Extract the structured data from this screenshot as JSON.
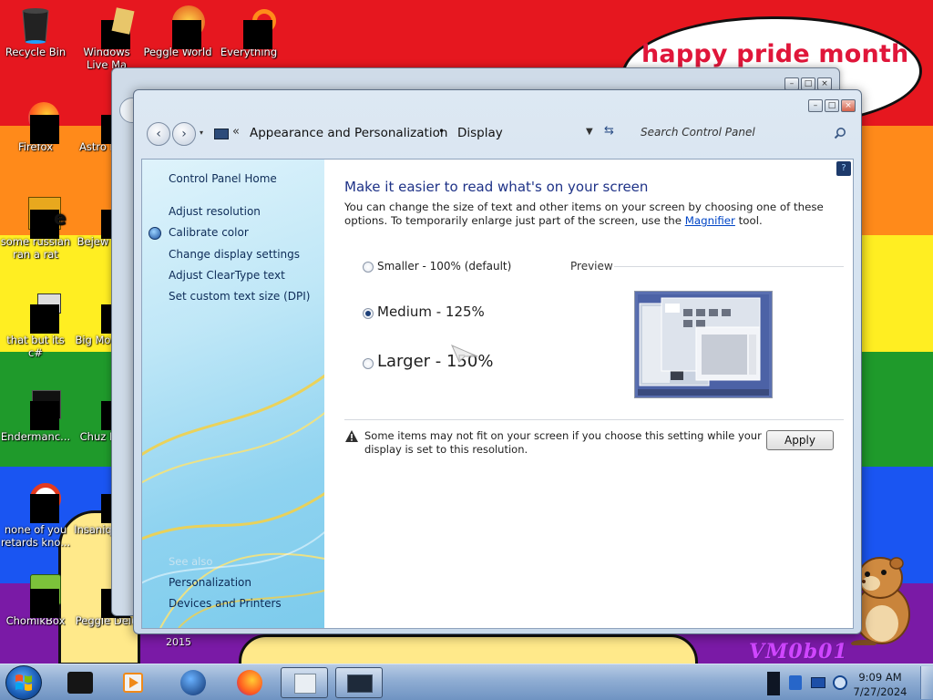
{
  "desktop": {
    "banner_text": "happy pride month",
    "watermark_text": "VM0b01",
    "partial_text": "2015",
    "icons": [
      {
        "label": "Recycle Bin"
      },
      {
        "label": "Windows Live Ma"
      },
      {
        "label": "Peggle World"
      },
      {
        "label": "Everything"
      },
      {
        "label": "Firefox"
      },
      {
        "label": "Astro Delu"
      },
      {
        "label": "some russian ran a rat"
      },
      {
        "label": "Bejew Delu"
      },
      {
        "label": "that but its c#"
      },
      {
        "label": "Big Mo Delu"
      },
      {
        "label": "Endermanc..."
      },
      {
        "label": "Chuz Delu"
      },
      {
        "label": "none of you retards kno..."
      },
      {
        "label": "Insaniq Delu"
      },
      {
        "label": "ChomikBox"
      },
      {
        "label": "Peggle Delu"
      }
    ]
  },
  "window": {
    "breadcrumb_root": "Appearance and Personalization",
    "breadcrumb_current": "Display",
    "search_placeholder": "Search Control Panel",
    "sidebar": {
      "home": "Control Panel Home",
      "links": [
        "Adjust resolution",
        "Calibrate color",
        "Change display settings",
        "Adjust ClearType text",
        "Set custom text size (DPI)"
      ],
      "see_also_heading": "See also",
      "see_also": [
        "Personalization",
        "Devices and Printers"
      ]
    },
    "main": {
      "heading": "Make it easier to read what's on your screen",
      "description_pre": "You can change the size of text and other items on your screen by choosing one of these options. To temporarily enlarge just part of the screen, use the ",
      "description_link": "Magnifier",
      "description_post": " tool.",
      "options": [
        {
          "label": "Smaller - 100% (default)",
          "checked": false
        },
        {
          "label": "Medium - 125%",
          "checked": true
        },
        {
          "label": "Larger - 150%",
          "checked": false
        }
      ],
      "preview_label": "Preview",
      "warning": "Some items may not fit on your screen if you choose this setting while your display is set to this resolution.",
      "apply_label": "Apply"
    }
  },
  "taskbar": {
    "time": "9:09 AM",
    "date": "7/27/2024"
  }
}
